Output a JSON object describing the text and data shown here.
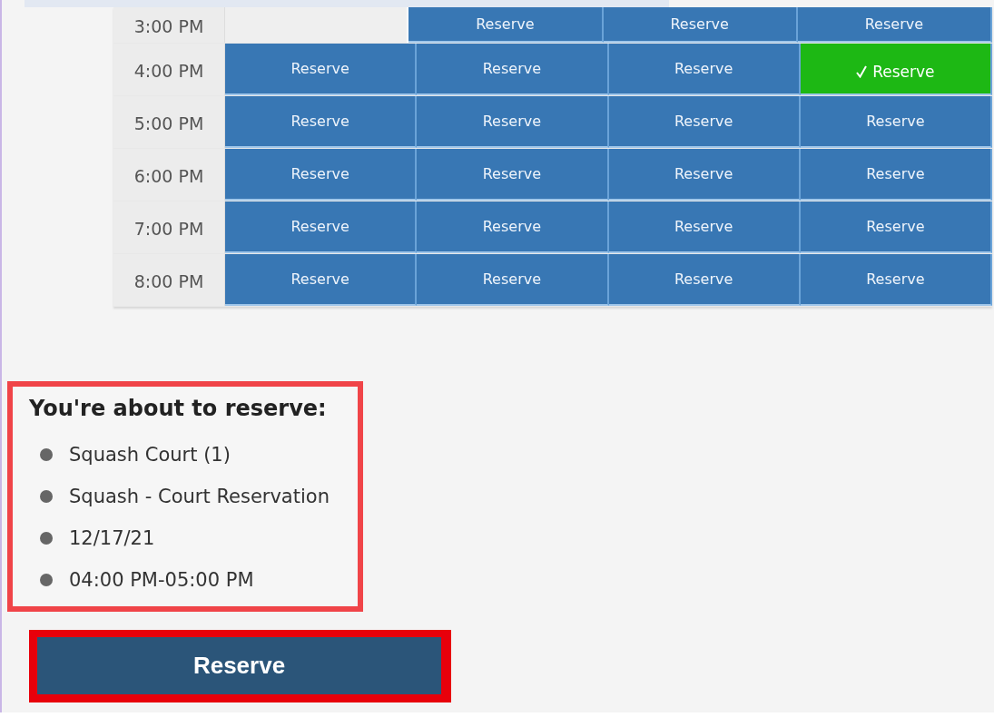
{
  "schedule": {
    "rows": [
      {
        "time": "3:00 PM",
        "slots": [
          {
            "kind": "empty",
            "selected": false
          },
          {
            "kind": "reserve",
            "label": "Reserve",
            "selected": false
          },
          {
            "kind": "reserve",
            "label": "Reserve",
            "selected": false
          },
          {
            "kind": "reserve",
            "label": "Reserve",
            "selected": false
          }
        ]
      },
      {
        "time": "4:00 PM",
        "slots": [
          {
            "kind": "reserve",
            "label": "Reserve",
            "selected": false
          },
          {
            "kind": "reserve",
            "label": "Reserve",
            "selected": false
          },
          {
            "kind": "reserve",
            "label": "Reserve",
            "selected": false
          },
          {
            "kind": "reserve",
            "label": "Reserve",
            "selected": true
          }
        ]
      },
      {
        "time": "5:00 PM",
        "slots": [
          {
            "kind": "reserve",
            "label": "Reserve",
            "selected": false
          },
          {
            "kind": "reserve",
            "label": "Reserve",
            "selected": false
          },
          {
            "kind": "reserve",
            "label": "Reserve",
            "selected": false
          },
          {
            "kind": "reserve",
            "label": "Reserve",
            "selected": false
          }
        ]
      },
      {
        "time": "6:00 PM",
        "slots": [
          {
            "kind": "reserve",
            "label": "Reserve",
            "selected": false
          },
          {
            "kind": "reserve",
            "label": "Reserve",
            "selected": false
          },
          {
            "kind": "reserve",
            "label": "Reserve",
            "selected": false
          },
          {
            "kind": "reserve",
            "label": "Reserve",
            "selected": false
          }
        ]
      },
      {
        "time": "7:00 PM",
        "slots": [
          {
            "kind": "reserve",
            "label": "Reserve",
            "selected": false
          },
          {
            "kind": "reserve",
            "label": "Reserve",
            "selected": false
          },
          {
            "kind": "reserve",
            "label": "Reserve",
            "selected": false
          },
          {
            "kind": "reserve",
            "label": "Reserve",
            "selected": false
          }
        ]
      },
      {
        "time": "8:00 PM",
        "slots": [
          {
            "kind": "reserve",
            "label": "Reserve",
            "selected": false
          },
          {
            "kind": "reserve",
            "label": "Reserve",
            "selected": false
          },
          {
            "kind": "reserve",
            "label": "Reserve",
            "selected": false
          },
          {
            "kind": "reserve",
            "label": "Reserve",
            "selected": false
          }
        ]
      }
    ]
  },
  "summary": {
    "heading": "You're about to reserve:",
    "items": [
      "Squash Court (1)",
      "Squash - Court Reservation",
      "12/17/21",
      "04:00 PM-05:00 PM"
    ]
  },
  "reserve_button": {
    "label": "Reserve"
  }
}
